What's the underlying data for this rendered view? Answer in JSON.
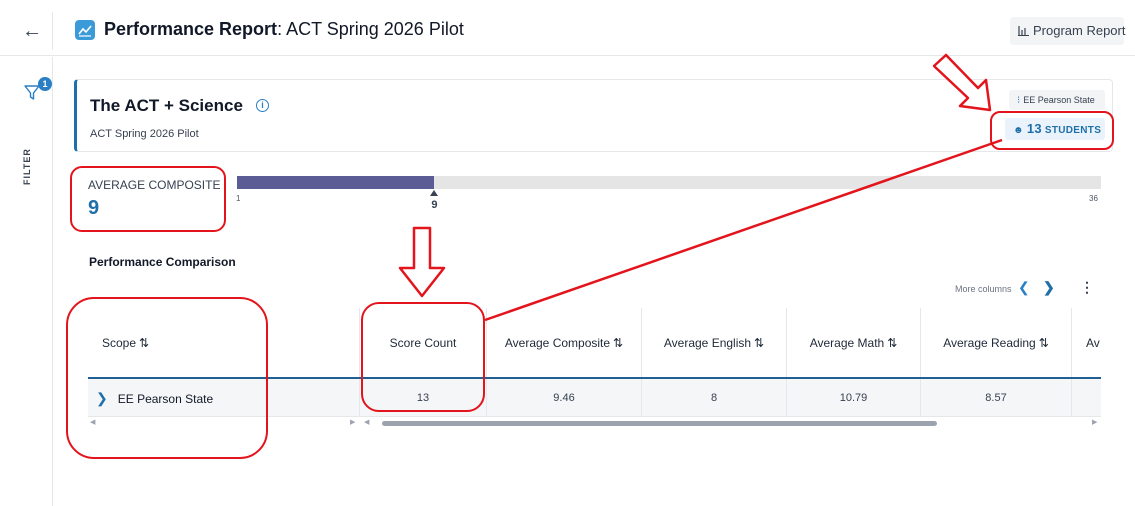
{
  "header": {
    "title_bold": "Performance Report",
    "title_rest": ": ACT Spring 2026 Pilot",
    "program_report_label": "Program Report"
  },
  "sidebar": {
    "filter_count": "1",
    "filter_label": "FILTER"
  },
  "card": {
    "title": "The ACT + Science",
    "subtitle": "ACT Spring 2026 Pilot",
    "scope_chip": "EE Pearson State",
    "students_count": "13",
    "students_label": "STUDENTS"
  },
  "average": {
    "label": "AVERAGE COMPOSITE",
    "value": "9",
    "scale_min": "1",
    "scale_max": "36",
    "marker_label": "9",
    "min": 1,
    "max": 36,
    "score": 9
  },
  "comparison": {
    "title": "Performance Comparison",
    "more_columns": "More columns",
    "columns": [
      {
        "label": "Scope",
        "sortable": true
      },
      {
        "label": "Score Count",
        "sortable": false
      },
      {
        "label": "Average Composite",
        "sortable": true
      },
      {
        "label": "Average English",
        "sortable": true
      },
      {
        "label": "Average Math",
        "sortable": true
      },
      {
        "label": "Average Reading",
        "sortable": true
      },
      {
        "label": "Av",
        "sortable": false
      }
    ],
    "rows": [
      {
        "scope": "EE Pearson State",
        "score_count": "13",
        "avg_composite": "9.46",
        "avg_english": "8",
        "avg_math": "10.79",
        "avg_reading": "8.57"
      }
    ]
  },
  "colors": {
    "accent": "#1f6fa8",
    "bar_fill": "#5b5b95",
    "annotation": "#e3141b"
  }
}
